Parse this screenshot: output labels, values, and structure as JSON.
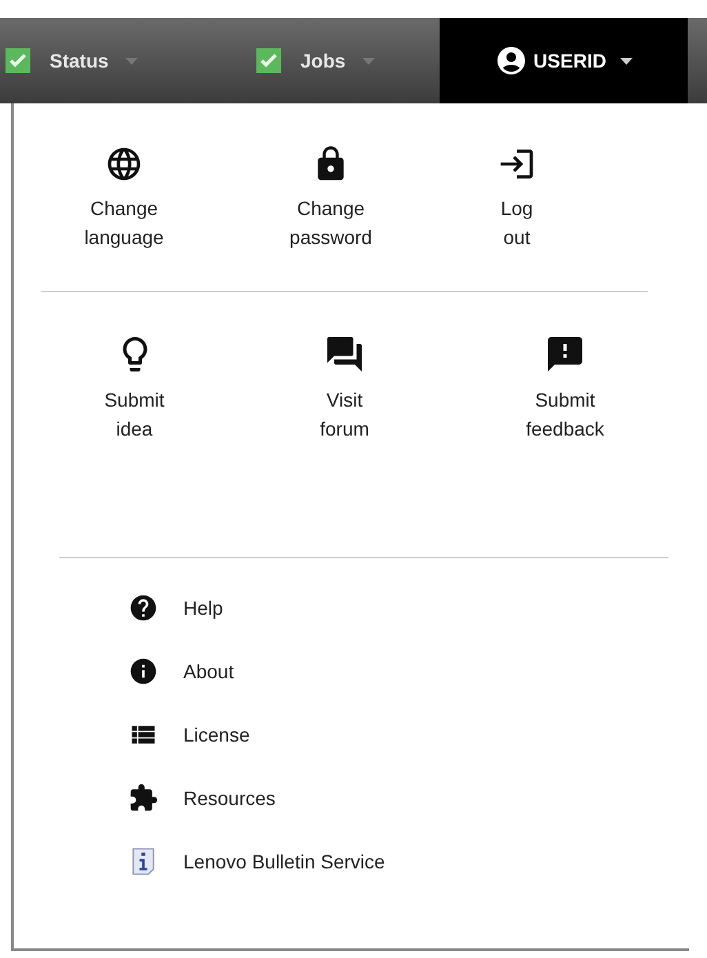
{
  "navbar": {
    "items": [
      {
        "label": "Status",
        "kind": "status"
      },
      {
        "label": "Jobs",
        "kind": "status"
      },
      {
        "label": "USERID",
        "kind": "user"
      }
    ]
  },
  "account_actions": [
    {
      "label": "Change language"
    },
    {
      "label": "Change password"
    },
    {
      "label": "Log out"
    }
  ],
  "community_actions": [
    {
      "label": "Submit idea"
    },
    {
      "label": "Visit forum"
    },
    {
      "label": "Submit feedback"
    }
  ],
  "links": [
    {
      "label": "Help"
    },
    {
      "label": "About"
    },
    {
      "label": "License"
    },
    {
      "label": "Resources"
    },
    {
      "label": "Lenovo Bulletin Service"
    }
  ]
}
